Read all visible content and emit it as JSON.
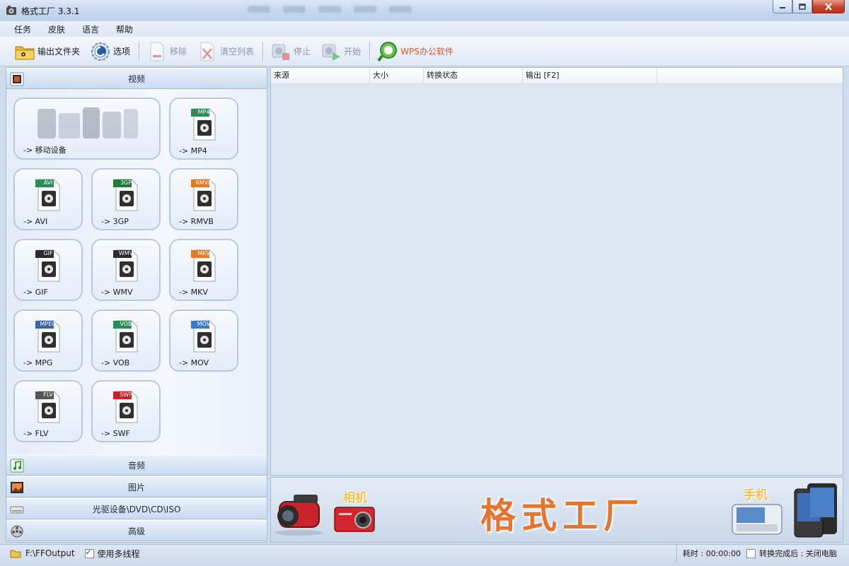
{
  "window": {
    "title": "格式工厂 3.3.1"
  },
  "menu": {
    "items": [
      "任务",
      "皮肤",
      "语言",
      "帮助"
    ]
  },
  "toolbar": {
    "output_folder": "输出文件夹",
    "options": "选项",
    "remove": "移除",
    "clear_list": "清空列表",
    "stop": "停止",
    "start": "开始",
    "wps": "WPS办公软件"
  },
  "left_panel": {
    "video_header": "视频",
    "tiles": [
      {
        "label": "-> 移动设备",
        "icon": "mobile-devices-icon"
      },
      {
        "label": "-> MP4",
        "icon": "mp4-file-icon",
        "tag": "MP4",
        "color": "#2e8b57"
      },
      {
        "label": "-> AVI",
        "icon": "avi-file-icon",
        "tag": "AVI",
        "color": "#2e8b57"
      },
      {
        "label": "-> 3GP",
        "icon": "3gp-file-icon",
        "tag": "3GP",
        "color": "#1f7a3a"
      },
      {
        "label": "-> RMVB",
        "icon": "rmvb-file-icon",
        "tag": "RMVB",
        "color": "#e07a2a"
      },
      {
        "label": "-> GIF",
        "icon": "gif-file-icon",
        "tag": "GIF",
        "color": "#2c2c2c"
      },
      {
        "label": "-> WMV",
        "icon": "wmv-file-icon",
        "tag": "WMV",
        "color": "#2c2c2c"
      },
      {
        "label": "-> MKV",
        "icon": "mkv-file-icon",
        "tag": "MKV",
        "color": "#e07a2a"
      },
      {
        "label": "-> MPG",
        "icon": "mpg-file-icon",
        "tag": "MPEG",
        "color": "#3a63a8"
      },
      {
        "label": "-> VOB",
        "icon": "vob-file-icon",
        "tag": "VOB",
        "color": "#2e8b57"
      },
      {
        "label": "-> MOV",
        "icon": "mov-file-icon",
        "tag": "MOV",
        "color": "#3a7ac8"
      },
      {
        "label": "-> FLV",
        "icon": "flv-file-icon",
        "tag": "FLV",
        "color": "#555555"
      },
      {
        "label": "-> SWF",
        "icon": "swf-file-icon",
        "tag": "SWF",
        "color": "#c7232b"
      }
    ],
    "audio_header": "音频",
    "picture_header": "图片",
    "disc_header": "光驱设备\\DVD\\CD\\ISO",
    "advanced_header": "高级"
  },
  "list": {
    "columns": [
      "来源",
      "大小",
      "转换状态",
      "输出 [F2]"
    ]
  },
  "banner": {
    "title": "格式工厂",
    "camera_tag": "相机",
    "phone_tag": "手机"
  },
  "status": {
    "output_path": "F:\\FFOutput",
    "multithread": "使用多线程",
    "elapsed": "耗时 : 00:00:00",
    "after_convert": "转换完成后 : 关闭电脑"
  },
  "colors": {
    "accent": "#e8732d",
    "panel": "#dce7f3",
    "header": "#c9dbf2"
  }
}
